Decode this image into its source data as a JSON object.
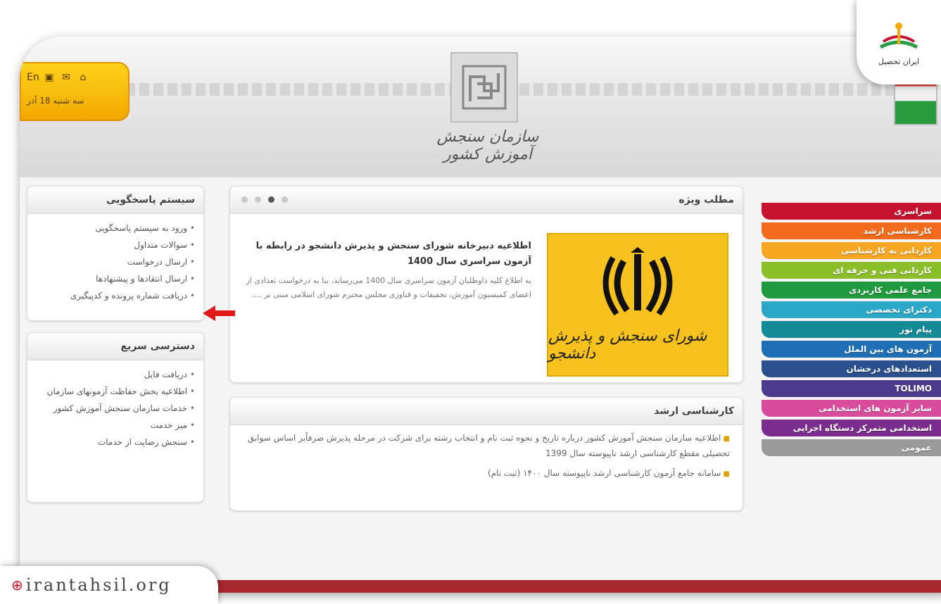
{
  "header": {
    "org_name": "سازمان سنجش آموزش کشور",
    "lang_label": "En",
    "date": "سه شنبه 18 آذر"
  },
  "left_panel_1": {
    "title": "سیستم پاسخگویی",
    "items": [
      "ورود به سیستم پاسخگویی",
      "سوالات متداول",
      "ارسال درخواست",
      "ارسال انتقادها و پیشنهادها",
      "دریافت شماره پرونده و کدپیگیری"
    ]
  },
  "left_panel_2": {
    "title": "دسترسی سریع",
    "items": [
      "دریافت فایل",
      "اطلاعیه بخش حفاظت آزمونهای سازمان",
      "خدمات سازمان سنجش آموزش کشور",
      "میز خدمت",
      "سنجش رضایت از خدمات"
    ]
  },
  "slider": {
    "title": "مطلب ویژه",
    "headline": "اطلاعیه دبیرخانه شورای سنجش و پذیرش دانشجو در رابطه با آزمون سراسری سال 1400",
    "body": "به اطلاع کلیه داوطلبان آزمون سراسری سال 1400 می‌رساند، بنا به درخواست تعدادی از اعضای کمیسیون آموزش، تحقیقات و فناوری مجلس محترم شورای اسلامی مبنی بر ....",
    "image_caption": "شورای سنجش و پذیرش دانشجو",
    "dots_total": 4,
    "dots_active": 2
  },
  "news": {
    "title": "کارشناسی ارشد",
    "items": [
      "اطلاعیه سازمان سنجش آموزش کشور درباره تاریخ و نحوه ثبت نام و انتخاب رشته برای شرکت در مرحله پذیرش صرفاًبر اساس سوابق تحصیلی مقطع کارشناسی ارشد ناپیوسته سال 1399",
      "سامانه جامع آزمون کارشناسی ارشد ناپیوسته سال ۱۴۰۰ (ثبت نام)"
    ]
  },
  "menu": [
    {
      "label": "سراسری",
      "color": "#c4122f"
    },
    {
      "label": "کارشناسی ارشد",
      "color": "#f26a1b"
    },
    {
      "label": "کاردانی به کارشناسی",
      "color": "#f5a623"
    },
    {
      "label": "کاردانی فنی و حرفه ای",
      "color": "#8bbf2a"
    },
    {
      "label": "جامع علمی کاربردی",
      "color": "#1f9a3e"
    },
    {
      "label": "دکترای تخصصی",
      "color": "#2ba7c8"
    },
    {
      "label": "پیام نور",
      "color": "#138a96"
    },
    {
      "label": "آزمون های بین الملل",
      "color": "#1f6fb5"
    },
    {
      "label": "استعدادهای درخشان",
      "color": "#2b4f8c"
    },
    {
      "label": "TOLIMO",
      "color": "#4a3b8f"
    },
    {
      "label": "سایر آزمون های استخدامی",
      "color": "#d94c9d"
    },
    {
      "label": "استخدامی متمرکز دستگاه اجرایی",
      "color": "#7a2d8c"
    },
    {
      "label": "عمومی",
      "color": "#9a9a9a"
    }
  ],
  "badge": {
    "name": "ایران تحصیل"
  },
  "watermark": {
    "text": "irantahsil.org"
  }
}
